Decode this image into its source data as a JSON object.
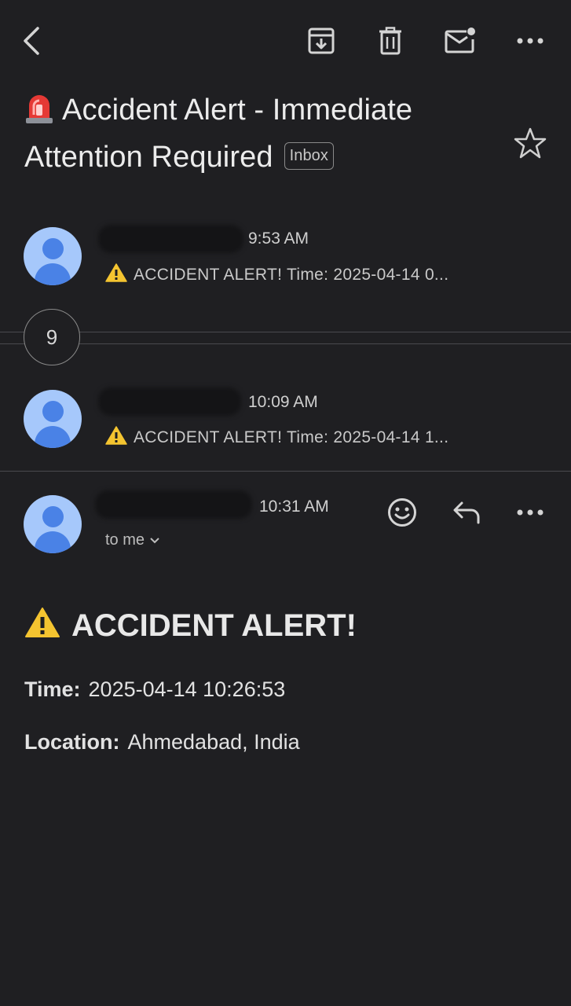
{
  "toolbar": {
    "icons": [
      "back-arrow-icon",
      "archive-icon",
      "trash-icon",
      "mark-unread-icon",
      "more-horizontal-icon"
    ]
  },
  "subject": {
    "emoji": "siren-icon",
    "text": "Accident Alert - Immediate Attention Required",
    "label": "Inbox"
  },
  "thread": {
    "messages": [
      {
        "time": "9:53 AM",
        "snippet": "ACCIDENT ALERT! Time: 2025-04-14 0..."
      },
      {
        "time": "10:09 AM",
        "snippet": "ACCIDENT ALERT! Time: 2025-04-14 1..."
      }
    ],
    "collapsed_count": "9"
  },
  "open_message": {
    "time": "10:31 AM",
    "recipient": "to me",
    "heading": "ACCIDENT ALERT!",
    "time_label": "Time:",
    "time_value": "2025-04-14 10:26:53",
    "location_label": "Location:",
    "location_value": "Ahmedabad, India"
  },
  "colors": {
    "background": "#1f1f22",
    "avatar_bg": "#a6c8fb",
    "avatar_fg": "#4a82e6",
    "warning": "#f4c430",
    "siren": "#e53935"
  }
}
